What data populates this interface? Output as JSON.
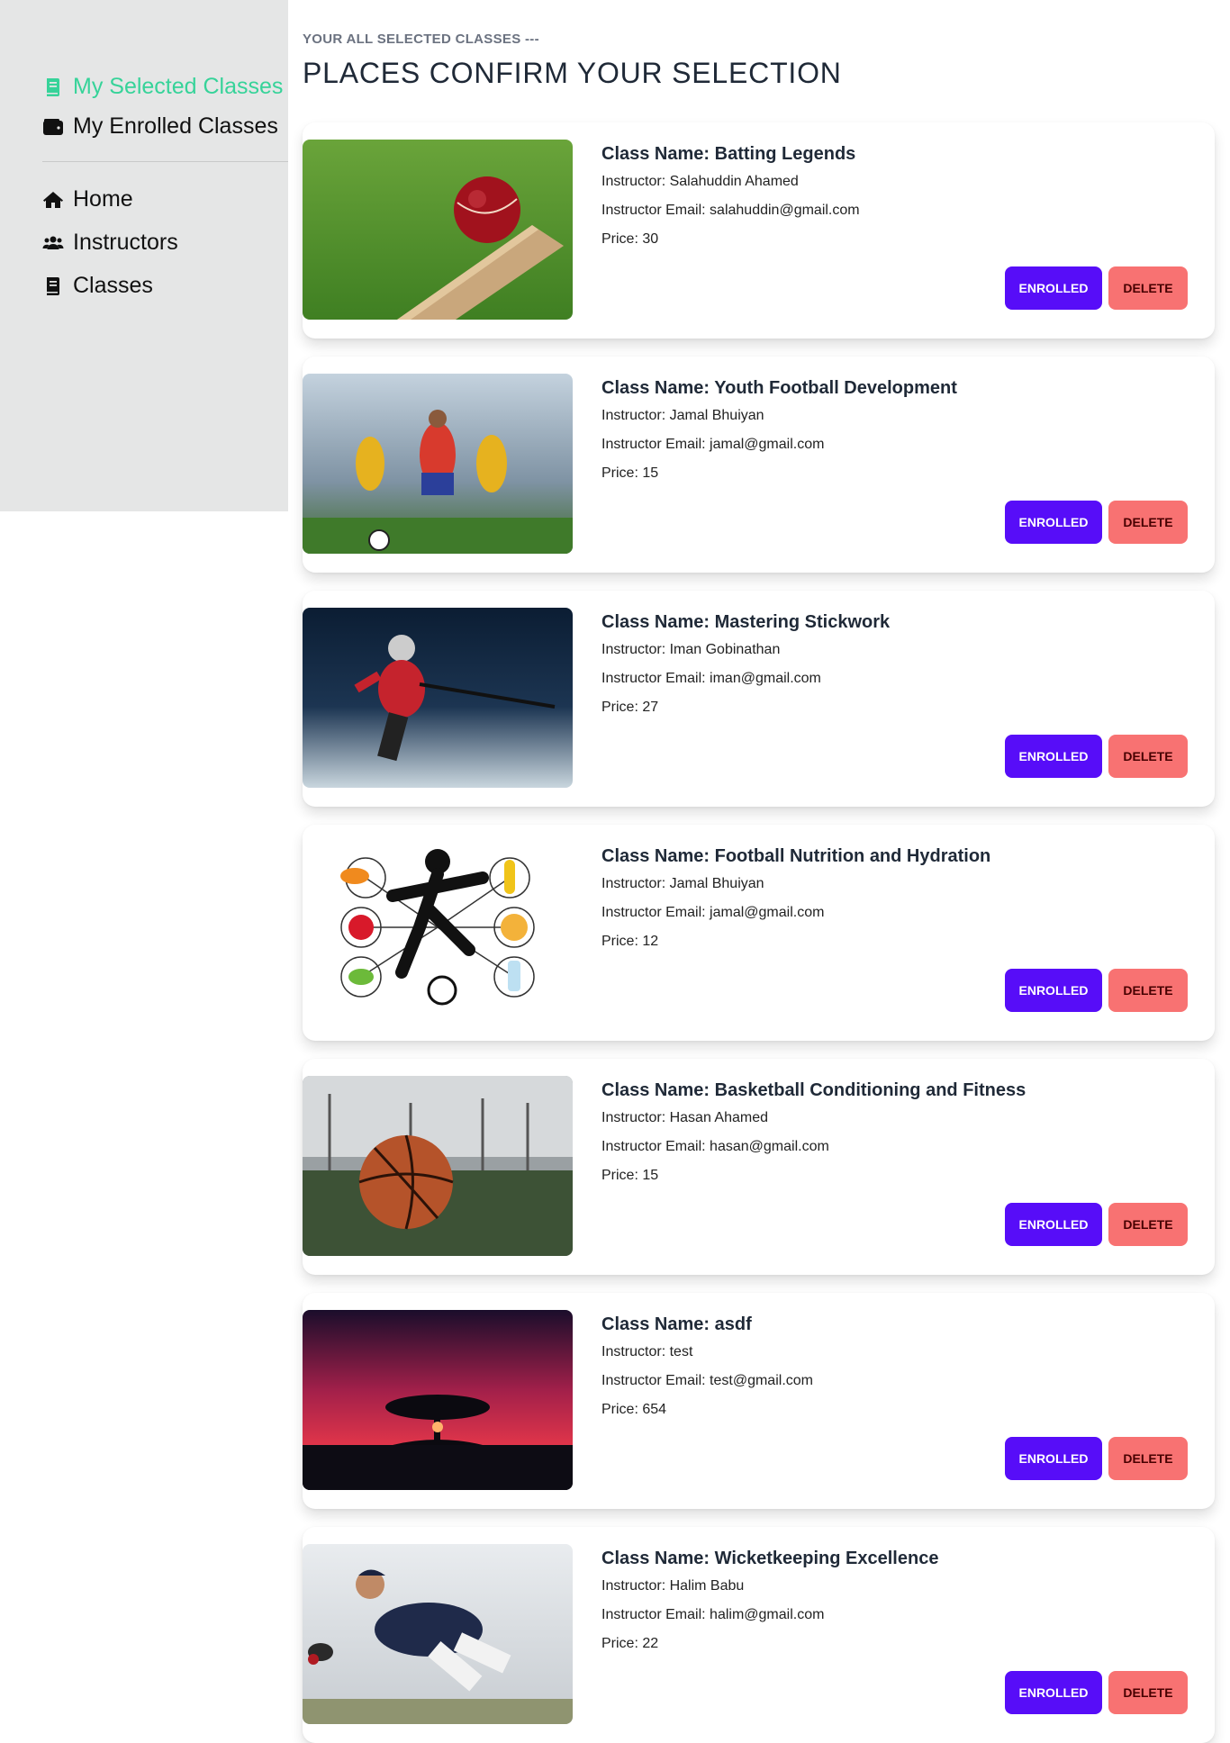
{
  "sidebar": {
    "items": [
      {
        "label": "My Selected Classes",
        "icon": "book-icon",
        "active": true
      },
      {
        "label": "My Enrolled Classes",
        "icon": "wallet-icon",
        "active": false
      },
      {
        "label": "Home",
        "icon": "home-icon",
        "active": false
      },
      {
        "label": "Instructors",
        "icon": "users-icon",
        "active": false
      },
      {
        "label": "Classes",
        "icon": "book-icon",
        "active": false
      }
    ]
  },
  "header": {
    "subtitle": "YOUR ALL SELECTED CLASSES ---",
    "title": "PLACES CONFIRM YOUR SELECTION"
  },
  "labels": {
    "class_name": "Class Name:",
    "instructor": "Instructor:",
    "email": "Instructor Email:",
    "price": "Price:",
    "enroll_button": "ENROLLED",
    "delete_button": "DELETE"
  },
  "classes": [
    {
      "name": "Batting Legends",
      "instructor": "Salahuddin Ahamed",
      "email": "salahuddin@gmail.com",
      "price": "30",
      "image": "cricket-ball-on-bat-photo"
    },
    {
      "name": "Youth Football Development",
      "instructor": "Jamal Bhuiyan",
      "email": "jamal@gmail.com",
      "price": "15",
      "image": "football-players-photo"
    },
    {
      "name": "Mastering Stickwork",
      "instructor": "Iman Gobinathan",
      "email": "iman@gmail.com",
      "price": "27",
      "image": "hockey-player-photo"
    },
    {
      "name": "Football Nutrition and Hydration",
      "instructor": "Jamal Bhuiyan",
      "email": "jamal@gmail.com",
      "price": "12",
      "image": "nutrition-diagram-illustration"
    },
    {
      "name": "Basketball Conditioning and Fitness",
      "instructor": "Hasan Ahamed",
      "email": "hasan@gmail.com",
      "price": "15",
      "image": "basketball-in-gym-photo"
    },
    {
      "name": "asdf",
      "instructor": "test",
      "email": "test@gmail.com",
      "price": "654",
      "image": "sunset-tree-photo"
    },
    {
      "name": "Wicketkeeping Excellence",
      "instructor": "Halim Babu",
      "email": "halim@gmail.com",
      "price": "22",
      "image": "wicketkeeper-photo"
    }
  ],
  "colors": {
    "sidebar_bg": "#e5e6e6",
    "active_nav": "#36d399",
    "enroll_button": "#570df8",
    "delete_button": "#f87272"
  }
}
